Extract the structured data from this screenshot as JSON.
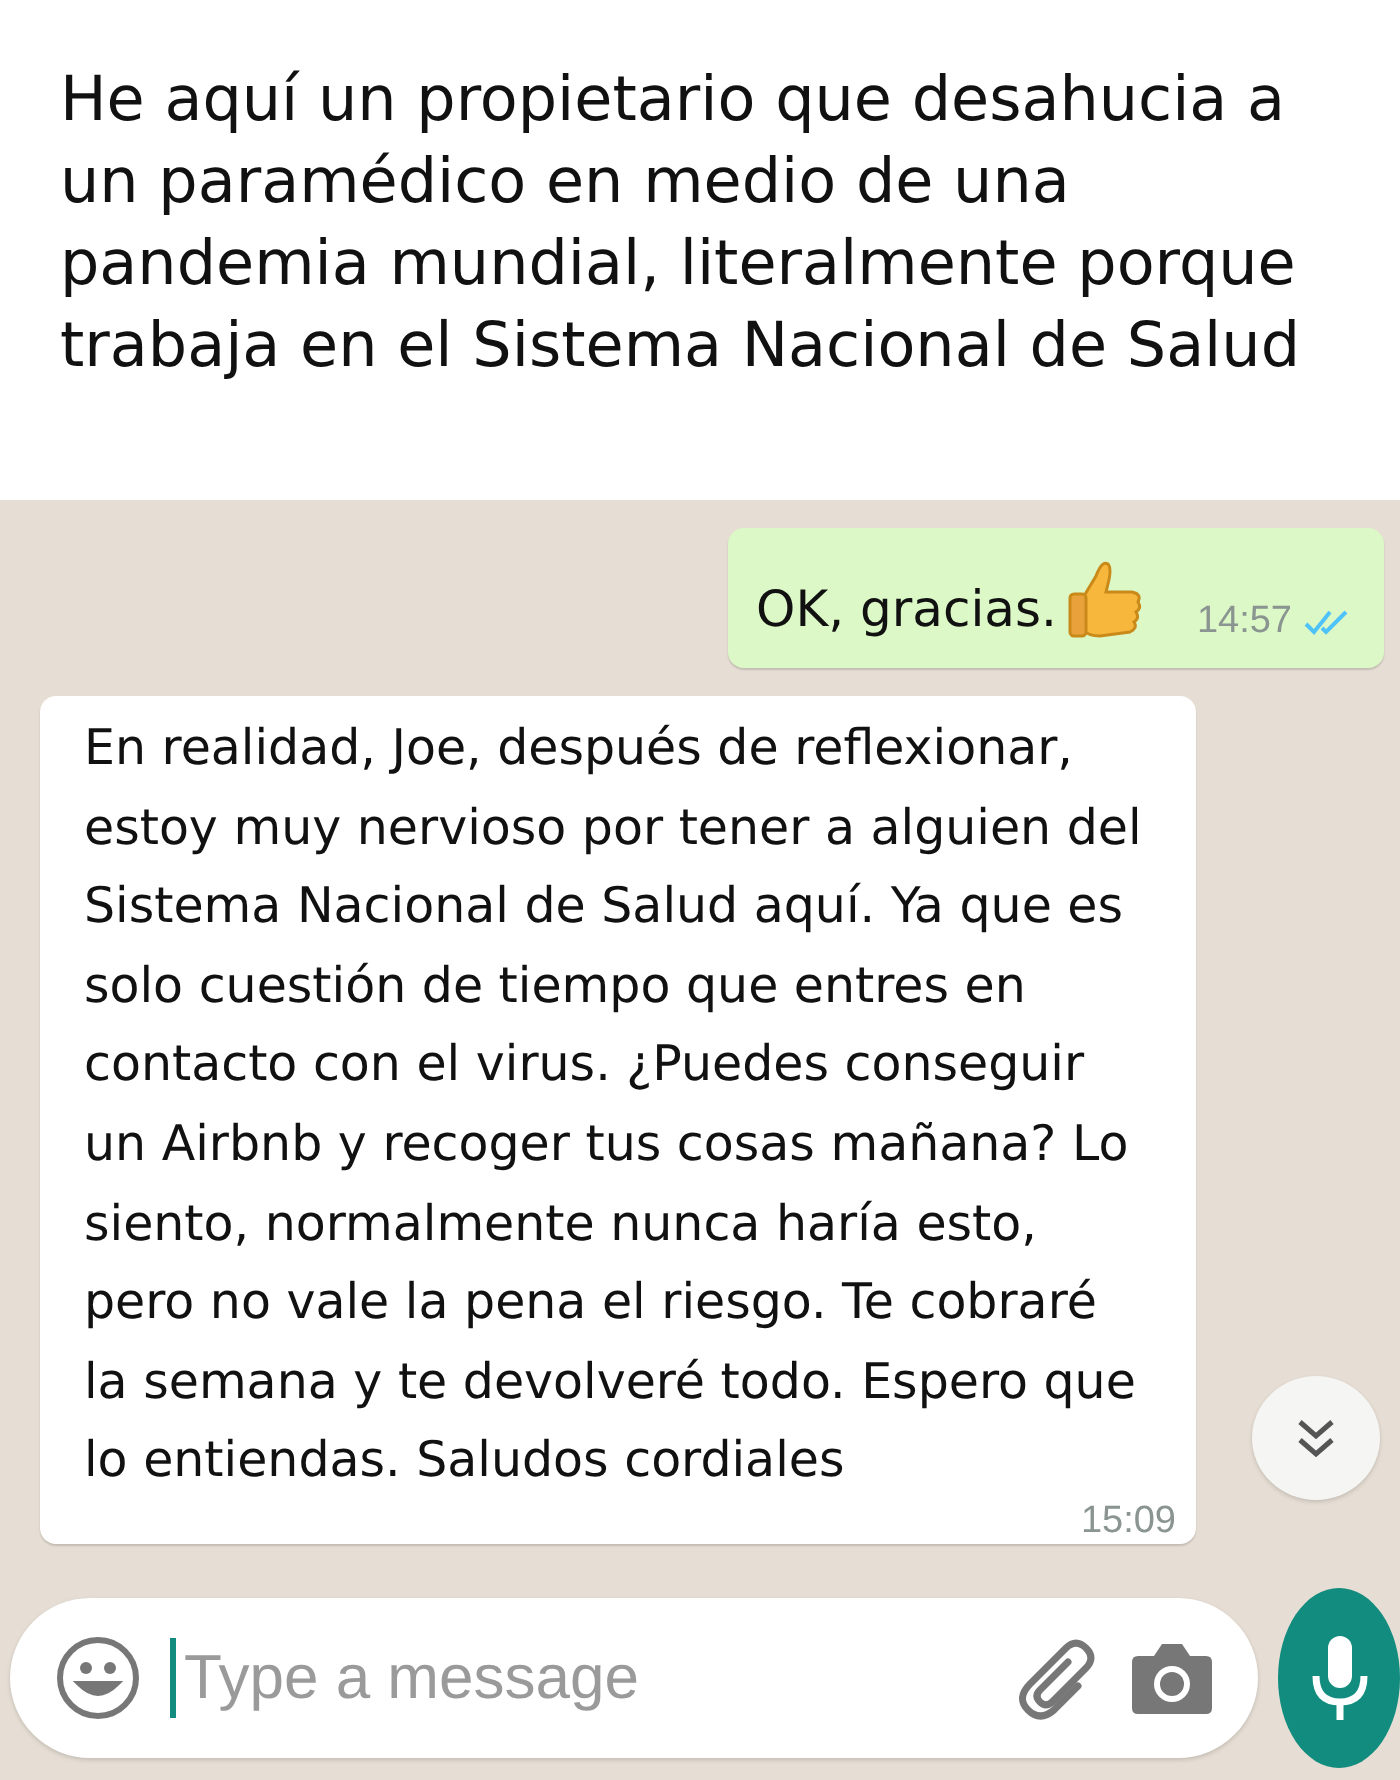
{
  "caption": "He aquí un propietario que desahucia a un paramédico en medio de una pandemia mundial, literalmente porque trabaja en el Sistema Nacional de Salud",
  "messages": [
    {
      "kind": "outgoing",
      "text": "OK, gracias.",
      "time": "14:57",
      "read": true
    },
    {
      "kind": "incoming",
      "text": "En realidad, Joe, después de reflexionar, estoy muy nervioso por tener a alguien del Sistema Nacional de Salud aquí. Ya que es solo cuestión de tiempo que entres en contacto con el virus. ¿Puedes conseguir un Airbnb y recoger tus cosas mañana? Lo siento, normalmente nunca haría esto, pero no vale la pena el riesgo. Te cobraré la semana y te devolveré todo. Espero que lo entiendas. Saludos cordiales",
      "time": "15:09"
    }
  ],
  "composer": {
    "placeholder": "Type a message"
  }
}
